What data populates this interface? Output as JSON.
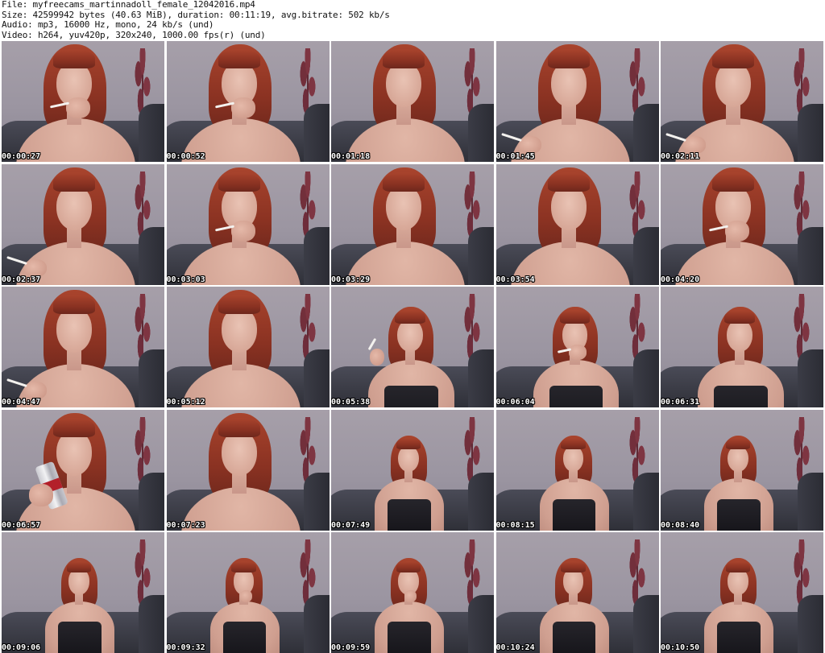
{
  "header": {
    "file_line": "File: myfreecams_martinnadoll_female_12042016.mp4",
    "size_line": "Size: 42599942 bytes (40.63 MiB), duration: 00:11:19, avg.bitrate: 502 kb/s",
    "audio_line": "Audio: mp3, 16000 Hz, mono, 24 kb/s (und)",
    "video_line": "Video: h264, yuv420p, 320x240, 1000.00 fps(r) (und)"
  },
  "thumbnails": [
    {
      "timestamp": "00:00:27",
      "scene": "close",
      "prop": "cigarette-mouth"
    },
    {
      "timestamp": "00:00:52",
      "scene": "close",
      "prop": "cigarette-mouth"
    },
    {
      "timestamp": "00:01:18",
      "scene": "close",
      "prop": "none"
    },
    {
      "timestamp": "00:01:45",
      "scene": "close",
      "prop": "cigarette-low"
    },
    {
      "timestamp": "00:02:11",
      "scene": "close",
      "prop": "cigarette-low"
    },
    {
      "timestamp": "00:02:37",
      "scene": "close",
      "prop": "cigarette-low"
    },
    {
      "timestamp": "00:03:03",
      "scene": "close",
      "prop": "cigarette-mouth"
    },
    {
      "timestamp": "00:03:29",
      "scene": "close",
      "prop": "none"
    },
    {
      "timestamp": "00:03:54",
      "scene": "close",
      "prop": "none"
    },
    {
      "timestamp": "00:04:20",
      "scene": "close",
      "prop": "cigarette-mouth"
    },
    {
      "timestamp": "00:04:47",
      "scene": "close",
      "prop": "cigarette-low"
    },
    {
      "timestamp": "00:05:12",
      "scene": "close",
      "prop": "none"
    },
    {
      "timestamp": "00:05:38",
      "scene": "mid",
      "prop": "cigarette-raised"
    },
    {
      "timestamp": "00:06:04",
      "scene": "mid",
      "prop": "cigarette-mouth"
    },
    {
      "timestamp": "00:06:31",
      "scene": "mid",
      "prop": "none"
    },
    {
      "timestamp": "00:06:57",
      "scene": "close",
      "prop": "can"
    },
    {
      "timestamp": "00:07:23",
      "scene": "close",
      "prop": "none"
    },
    {
      "timestamp": "00:07:49",
      "scene": "far",
      "prop": "none"
    },
    {
      "timestamp": "00:08:15",
      "scene": "far",
      "prop": "none"
    },
    {
      "timestamp": "00:08:40",
      "scene": "far",
      "prop": "none"
    },
    {
      "timestamp": "00:09:06",
      "scene": "far",
      "prop": "none"
    },
    {
      "timestamp": "00:09:32",
      "scene": "far",
      "prop": "hand-chin"
    },
    {
      "timestamp": "00:09:59",
      "scene": "far",
      "prop": "hand-chin"
    },
    {
      "timestamp": "00:10:24",
      "scene": "far",
      "prop": "none"
    },
    {
      "timestamp": "00:10:50",
      "scene": "far",
      "prop": "none"
    }
  ]
}
